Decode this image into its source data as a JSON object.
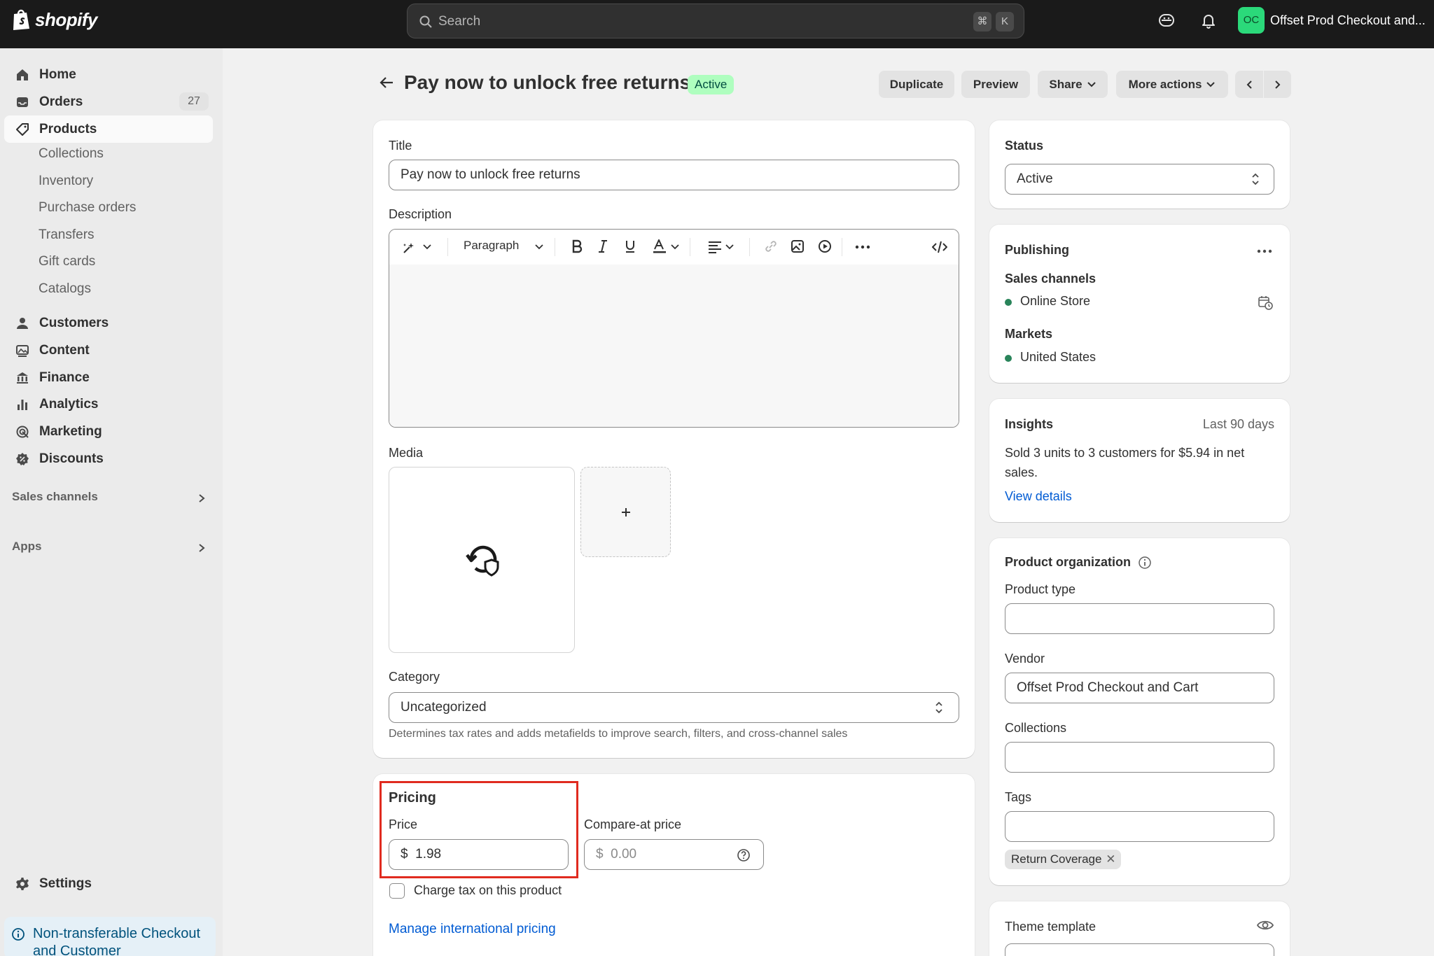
{
  "topbar": {
    "logo_text": "shopify",
    "search_placeholder": "Search",
    "kbd_cmd": "⌘",
    "kbd_key": "K",
    "avatar_initials": "OC",
    "store_name": "Offset Prod Checkout and..."
  },
  "sidebar": {
    "home": "Home",
    "orders": "Orders",
    "orders_count": "27",
    "products": "Products",
    "sub_items": [
      "Collections",
      "Inventory",
      "Purchase orders",
      "Transfers",
      "Gift cards",
      "Catalogs"
    ],
    "customers": "Customers",
    "content": "Content",
    "finance": "Finance",
    "analytics": "Analytics",
    "marketing": "Marketing",
    "discounts": "Discounts",
    "sales_channels": "Sales channels",
    "apps": "Apps",
    "settings": "Settings",
    "notice": "Non-transferable Checkout and Customer"
  },
  "header": {
    "title": "Pay now to unlock free returns",
    "status_badge": "Active",
    "duplicate": "Duplicate",
    "preview": "Preview",
    "share": "Share",
    "more_actions": "More actions"
  },
  "main": {
    "title_label": "Title",
    "title_value": "Pay now to unlock free returns",
    "description_label": "Description",
    "paragraph": "Paragraph",
    "media_label": "Media",
    "category_label": "Category",
    "category_value": "Uncategorized",
    "category_help": "Determines tax rates and adds metafields to improve search, filters, and cross-channel sales",
    "pricing_label": "Pricing",
    "price_label": "Price",
    "currency": "$",
    "price_value": "1.98",
    "compare_label": "Compare-at price",
    "compare_value": "0.00",
    "charge_tax": "Charge tax on this product",
    "manage_intl": "Manage international pricing"
  },
  "side": {
    "status_label": "Status",
    "status_value": "Active",
    "publishing_label": "Publishing",
    "sales_channels_label": "Sales channels",
    "online_store": "Online Store",
    "markets_label": "Markets",
    "united_states": "United States",
    "insights_label": "Insights",
    "insights_range": "Last 90 days",
    "insights_text": "Sold 3 units to 3 customers for $5.94 in net sales.",
    "view_details": "View details",
    "org_label": "Product organization",
    "product_type_label": "Product type",
    "product_type_value": "",
    "vendor_label": "Vendor",
    "vendor_value": "Offset Prod Checkout and Cart",
    "collections_label": "Collections",
    "collections_value": "",
    "tags_label": "Tags",
    "tags_value": "",
    "tag_chip": "Return Coverage",
    "theme_template_label": "Theme template"
  },
  "colors": {
    "topbar": "#1a1a1a",
    "sidebar": "#ebebeb",
    "active_badge": "#affebf",
    "link": "#005bd3",
    "highlight_border": "#e02b1f",
    "status_dot": "#29845a"
  }
}
